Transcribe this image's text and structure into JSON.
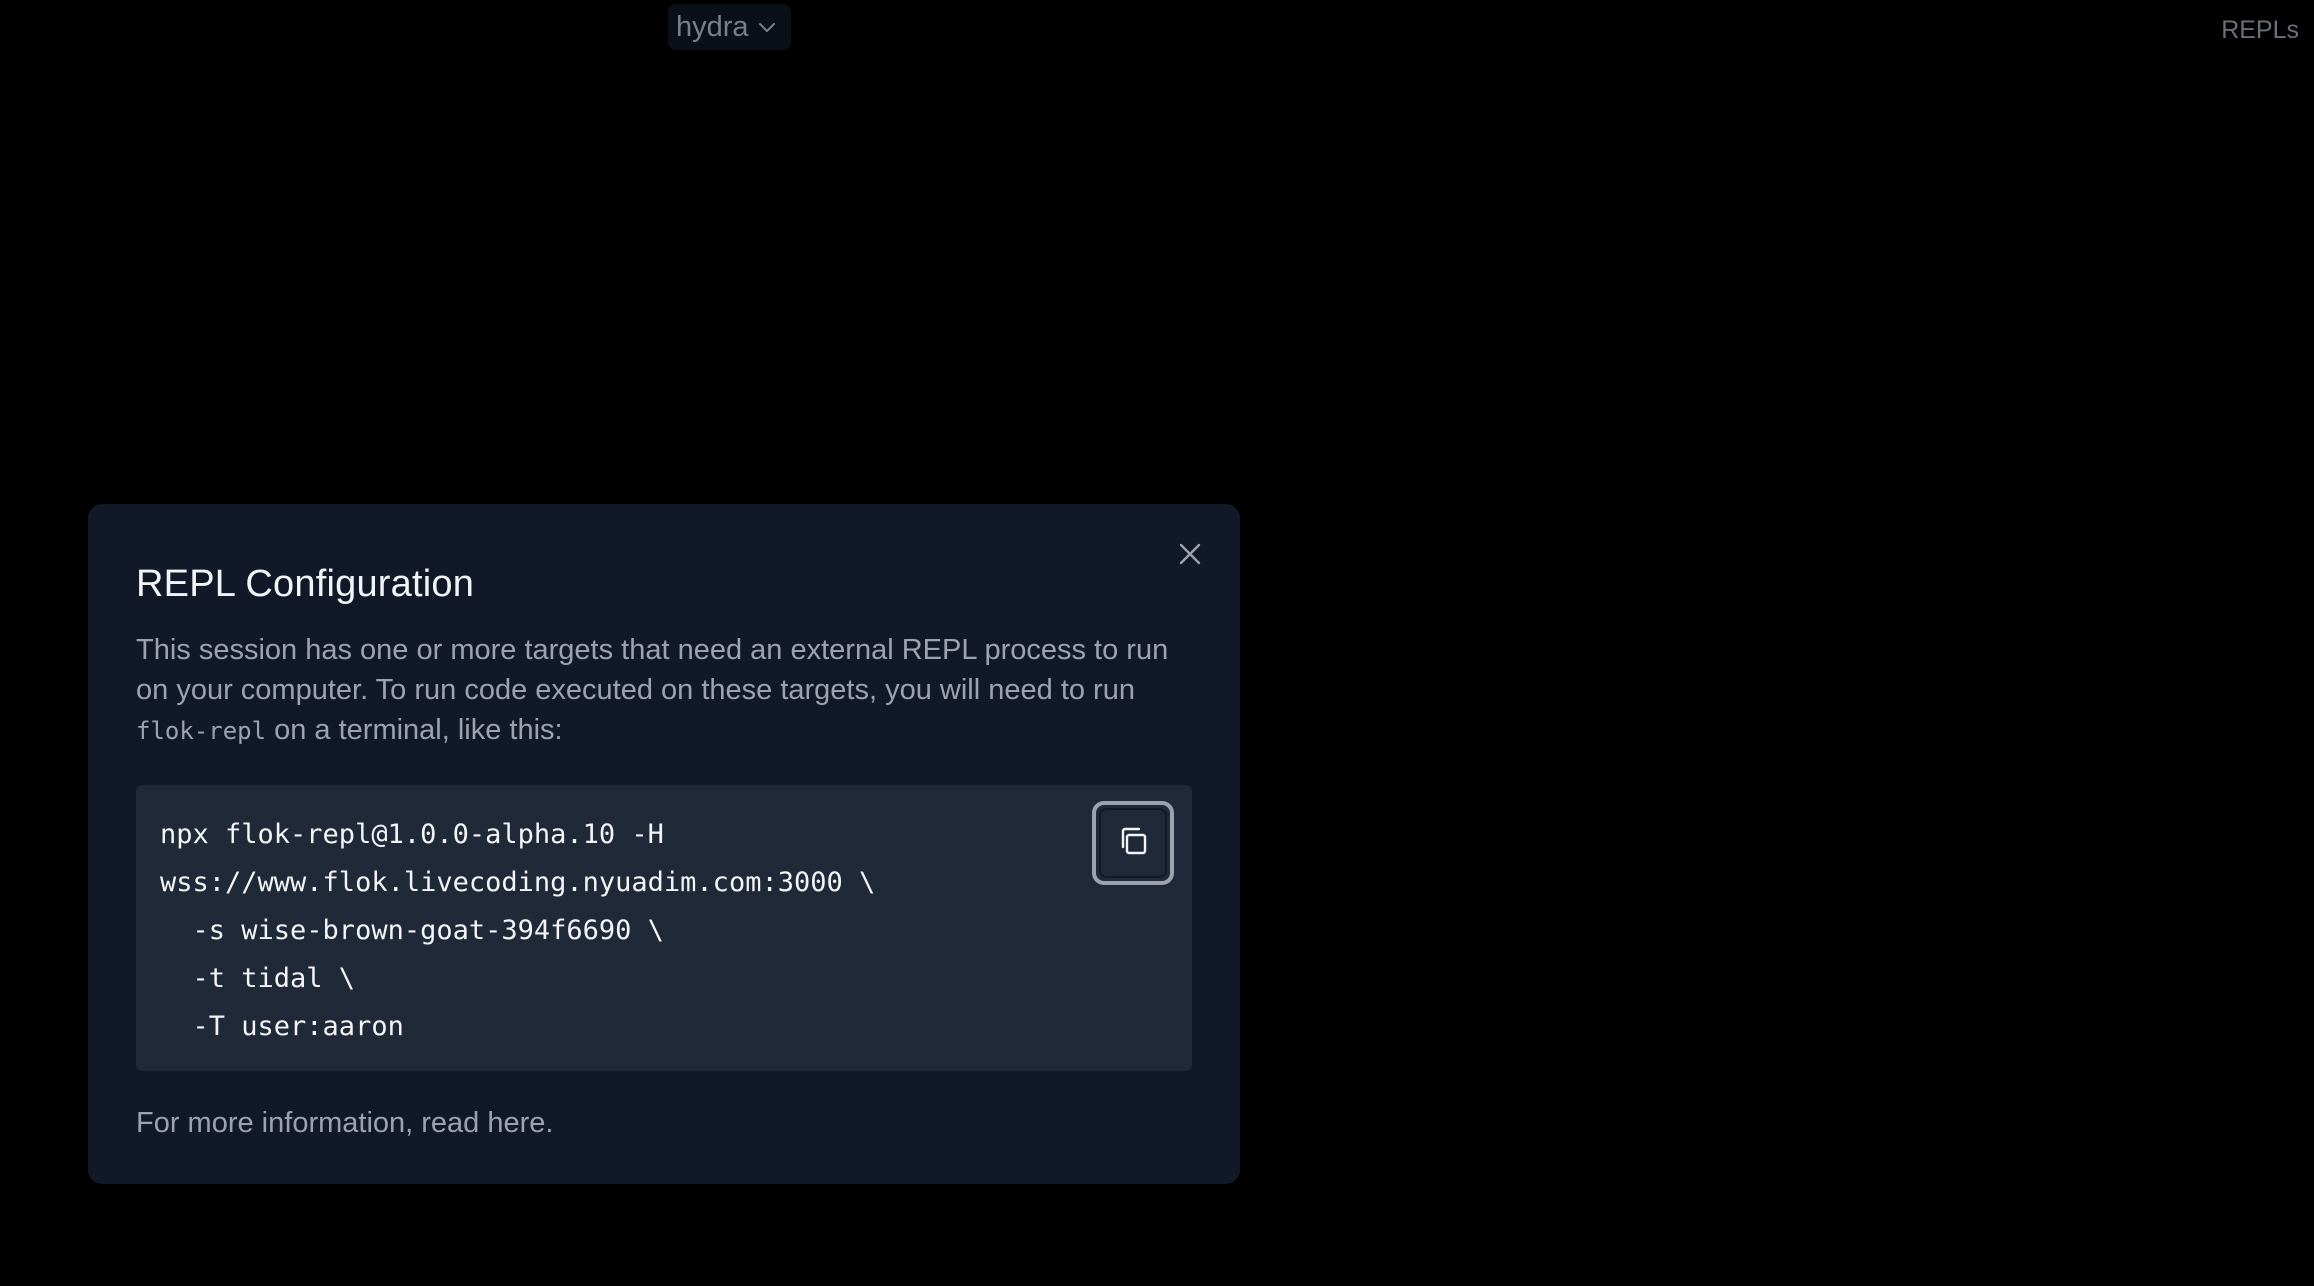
{
  "header": {
    "target_select_value": "hydra",
    "repls_link": "REPLs"
  },
  "dialog": {
    "title": "REPL Configuration",
    "description_before": "This session has one or more targets that need an external REPL process to run on your computer. To run code executed on these targets, you will need to run ",
    "description_code": "flok-repl",
    "description_after": " on a terminal, like this:",
    "code_lines": [
      "npx flok-repl@1.0.0-alpha.10 -H",
      "wss://www.flok.livecoding.nyuadim.com:3000 \\",
      "  -s wise-brown-goat-394f6690 \\",
      "  -t tidal \\",
      "  -T user:aaron"
    ],
    "footer_text": "For more information, read here."
  },
  "icons": {
    "close": "close-icon",
    "copy": "copy-icon",
    "chevron": "chevron-down-icon"
  },
  "colors": {
    "background": "#000000",
    "dialog_bg": "#111827",
    "code_bg": "#1f2937",
    "title_text": "#f3f4f6",
    "muted_text": "#9ca3af"
  }
}
